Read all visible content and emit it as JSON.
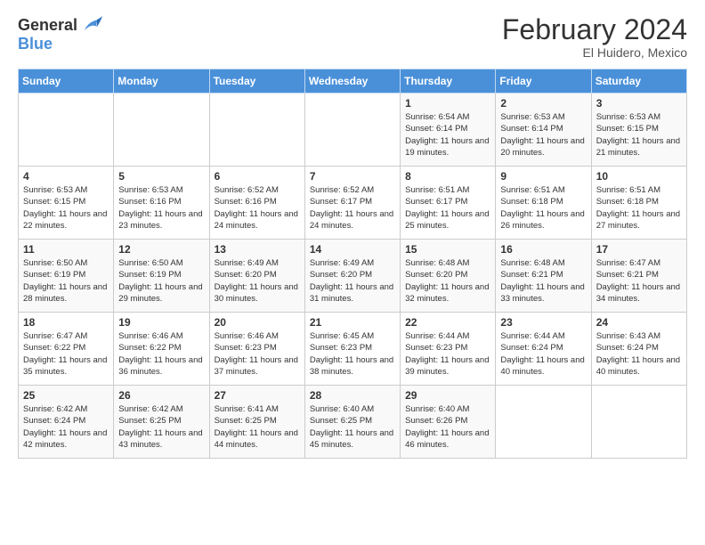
{
  "header": {
    "logo_general": "General",
    "logo_blue": "Blue",
    "title": "February 2024",
    "subtitle": "El Huidero, Mexico"
  },
  "days_of_week": [
    "Sunday",
    "Monday",
    "Tuesday",
    "Wednesday",
    "Thursday",
    "Friday",
    "Saturday"
  ],
  "weeks": [
    [
      {
        "day": "",
        "info": ""
      },
      {
        "day": "",
        "info": ""
      },
      {
        "day": "",
        "info": ""
      },
      {
        "day": "",
        "info": ""
      },
      {
        "day": "1",
        "info": "Sunrise: 6:54 AM\nSunset: 6:14 PM\nDaylight: 11 hours and 19 minutes."
      },
      {
        "day": "2",
        "info": "Sunrise: 6:53 AM\nSunset: 6:14 PM\nDaylight: 11 hours and 20 minutes."
      },
      {
        "day": "3",
        "info": "Sunrise: 6:53 AM\nSunset: 6:15 PM\nDaylight: 11 hours and 21 minutes."
      }
    ],
    [
      {
        "day": "4",
        "info": "Sunrise: 6:53 AM\nSunset: 6:15 PM\nDaylight: 11 hours and 22 minutes."
      },
      {
        "day": "5",
        "info": "Sunrise: 6:53 AM\nSunset: 6:16 PM\nDaylight: 11 hours and 23 minutes."
      },
      {
        "day": "6",
        "info": "Sunrise: 6:52 AM\nSunset: 6:16 PM\nDaylight: 11 hours and 24 minutes."
      },
      {
        "day": "7",
        "info": "Sunrise: 6:52 AM\nSunset: 6:17 PM\nDaylight: 11 hours and 24 minutes."
      },
      {
        "day": "8",
        "info": "Sunrise: 6:51 AM\nSunset: 6:17 PM\nDaylight: 11 hours and 25 minutes."
      },
      {
        "day": "9",
        "info": "Sunrise: 6:51 AM\nSunset: 6:18 PM\nDaylight: 11 hours and 26 minutes."
      },
      {
        "day": "10",
        "info": "Sunrise: 6:51 AM\nSunset: 6:18 PM\nDaylight: 11 hours and 27 minutes."
      }
    ],
    [
      {
        "day": "11",
        "info": "Sunrise: 6:50 AM\nSunset: 6:19 PM\nDaylight: 11 hours and 28 minutes."
      },
      {
        "day": "12",
        "info": "Sunrise: 6:50 AM\nSunset: 6:19 PM\nDaylight: 11 hours and 29 minutes."
      },
      {
        "day": "13",
        "info": "Sunrise: 6:49 AM\nSunset: 6:20 PM\nDaylight: 11 hours and 30 minutes."
      },
      {
        "day": "14",
        "info": "Sunrise: 6:49 AM\nSunset: 6:20 PM\nDaylight: 11 hours and 31 minutes."
      },
      {
        "day": "15",
        "info": "Sunrise: 6:48 AM\nSunset: 6:20 PM\nDaylight: 11 hours and 32 minutes."
      },
      {
        "day": "16",
        "info": "Sunrise: 6:48 AM\nSunset: 6:21 PM\nDaylight: 11 hours and 33 minutes."
      },
      {
        "day": "17",
        "info": "Sunrise: 6:47 AM\nSunset: 6:21 PM\nDaylight: 11 hours and 34 minutes."
      }
    ],
    [
      {
        "day": "18",
        "info": "Sunrise: 6:47 AM\nSunset: 6:22 PM\nDaylight: 11 hours and 35 minutes."
      },
      {
        "day": "19",
        "info": "Sunrise: 6:46 AM\nSunset: 6:22 PM\nDaylight: 11 hours and 36 minutes."
      },
      {
        "day": "20",
        "info": "Sunrise: 6:46 AM\nSunset: 6:23 PM\nDaylight: 11 hours and 37 minutes."
      },
      {
        "day": "21",
        "info": "Sunrise: 6:45 AM\nSunset: 6:23 PM\nDaylight: 11 hours and 38 minutes."
      },
      {
        "day": "22",
        "info": "Sunrise: 6:44 AM\nSunset: 6:23 PM\nDaylight: 11 hours and 39 minutes."
      },
      {
        "day": "23",
        "info": "Sunrise: 6:44 AM\nSunset: 6:24 PM\nDaylight: 11 hours and 40 minutes."
      },
      {
        "day": "24",
        "info": "Sunrise: 6:43 AM\nSunset: 6:24 PM\nDaylight: 11 hours and 40 minutes."
      }
    ],
    [
      {
        "day": "25",
        "info": "Sunrise: 6:42 AM\nSunset: 6:24 PM\nDaylight: 11 hours and 42 minutes."
      },
      {
        "day": "26",
        "info": "Sunrise: 6:42 AM\nSunset: 6:25 PM\nDaylight: 11 hours and 43 minutes."
      },
      {
        "day": "27",
        "info": "Sunrise: 6:41 AM\nSunset: 6:25 PM\nDaylight: 11 hours and 44 minutes."
      },
      {
        "day": "28",
        "info": "Sunrise: 6:40 AM\nSunset: 6:25 PM\nDaylight: 11 hours and 45 minutes."
      },
      {
        "day": "29",
        "info": "Sunrise: 6:40 AM\nSunset: 6:26 PM\nDaylight: 11 hours and 46 minutes."
      },
      {
        "day": "",
        "info": ""
      },
      {
        "day": "",
        "info": ""
      }
    ]
  ]
}
